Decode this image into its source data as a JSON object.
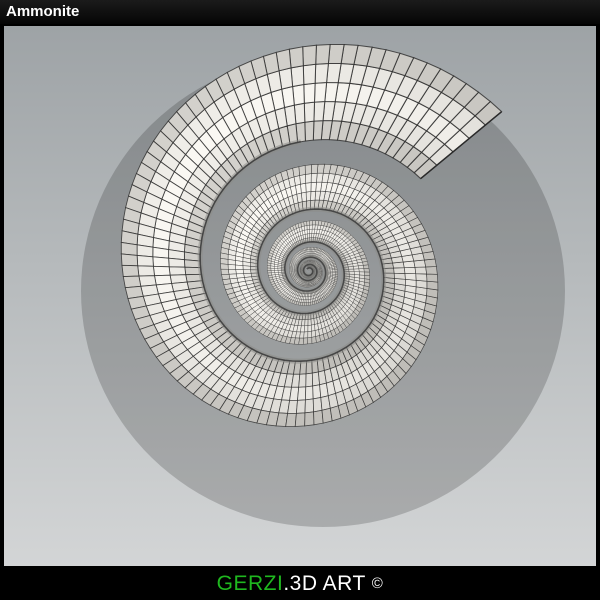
{
  "window": {
    "title": "Ammonite"
  },
  "footer": {
    "brand_green": "GERZI",
    "brand_white": ".3D ART",
    "copyright_symbol": "©"
  },
  "render": {
    "subject-icon": "ammonite-wireframe",
    "colors": {
      "shell": "#e9e7e1",
      "shell_shadow": "#8d8c88",
      "wire": "#2a2a2a",
      "background_top": "#9ea3a6",
      "background_bottom": "#d3d5d6"
    }
  }
}
